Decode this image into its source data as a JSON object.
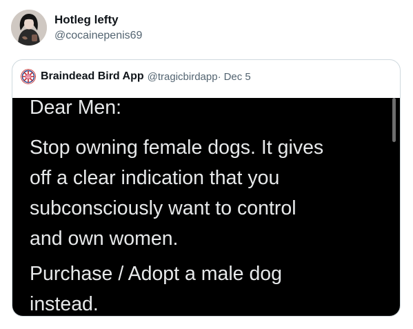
{
  "author": {
    "display_name": "Hotleg lefty",
    "handle": "@cocainepenis69",
    "avatar_icon": "user-avatar-photo"
  },
  "quoted_tweet": {
    "display_name": "Braindead Bird App",
    "handle": "@tragicbirdapp",
    "separator": "·",
    "date": "Dec 5",
    "avatar_icon": "brain-logo-avatar",
    "media": {
      "background": "#000000",
      "text_color": "#e7e9ea",
      "greeting": "Dear Men:",
      "body_lines": [
        "Stop owning female dogs. It gives",
        "off a clear indication that you",
        "subconsciously want to control",
        "and own women."
      ],
      "cta_lines": [
        "Purchase / Adopt a male dog",
        "instead."
      ]
    }
  }
}
